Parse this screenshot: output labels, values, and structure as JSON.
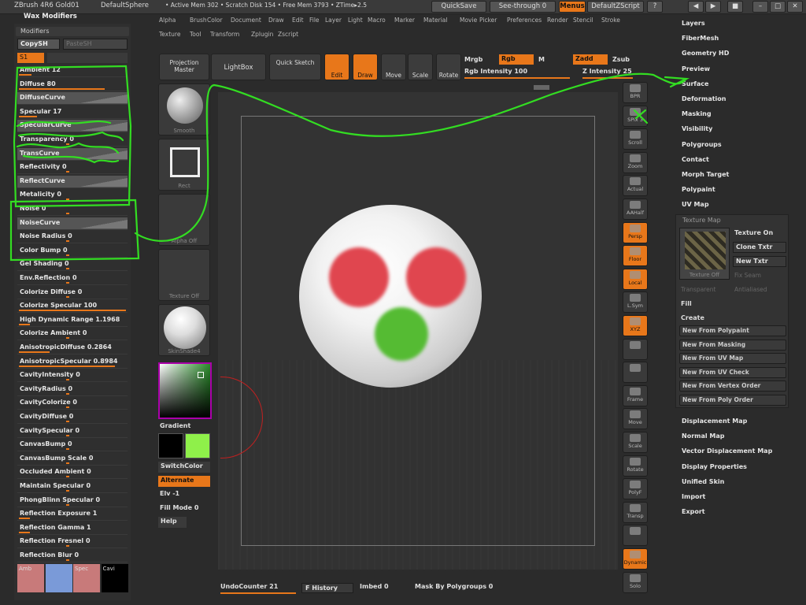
{
  "titlebar": {
    "app": "ZBrush 4R6 Gold01",
    "doc": "DefaultSphere",
    "mem": "• Active Mem 302  • Scratch Disk 154  • Free Mem 3793  • ZTime▸2.5",
    "quicksave": "QuickSave",
    "seethrough": "See-through  0",
    "menus": "Menus",
    "script": "DefaultZScript"
  },
  "menubar": {
    "row1": [
      "Alpha",
      "Brush",
      "Color",
      "Document",
      "Draw",
      "Edit",
      "File",
      "Layer",
      "Light",
      "Macro",
      "Marker",
      "Material",
      "Movie",
      "Picker",
      "Preferences",
      "Render",
      "Stencil",
      "Stroke"
    ],
    "row2": [
      "Texture",
      "Tool",
      "Transform",
      "Zplugin",
      "Zscript"
    ]
  },
  "leftpanel": {
    "title": "Wax Modifiers",
    "modifiers": "Modifiers",
    "copy": "CopySH",
    "paste": "PasteSH",
    "s1": "S1",
    "rows": [
      {
        "label": "Ambient 12",
        "fill": 0.12
      },
      {
        "label": "Diffuse 80",
        "fill": 0.8
      },
      {
        "label": "DiffuseCurve",
        "curve": true
      },
      {
        "label": "Specular 17",
        "fill": 0.17
      },
      {
        "label": "SpecularCurve",
        "curve": true
      },
      {
        "label": "Transparency 0",
        "fill": 0
      },
      {
        "label": "TransCurve",
        "curve": true
      },
      {
        "label": "Reflectivity 0",
        "fill": 0
      },
      {
        "label": "ReflectCurve",
        "curve": true
      },
      {
        "label": "Metalicity 0",
        "fill": 0
      },
      {
        "label": "Noise 0",
        "fill": 0
      },
      {
        "label": "NoiseCurve",
        "curve": true
      },
      {
        "label": "Noise Radius 0",
        "fill": 0
      },
      {
        "label": "Color Bump 0",
        "fill": 0
      },
      {
        "label": "Gel Shading 0",
        "fill": 0
      },
      {
        "label": "Env.Reflection 0",
        "fill": 0
      },
      {
        "label": "Colorize Diffuse 0",
        "fill": 0
      },
      {
        "label": "Colorize Specular 100",
        "fill": 1
      },
      {
        "label": "High Dynamic Range 1.1968",
        "fill": 0.1
      },
      {
        "label": "Colorize Ambient 0",
        "fill": 0
      },
      {
        "label": "AnisotropicDiffuse 0.2864",
        "fill": 0.29
      },
      {
        "label": "AnisotropicSpecular 0.8984",
        "fill": 0.9
      },
      {
        "label": "CavityIntensity 0",
        "fill": 0
      },
      {
        "label": "CavityRadius 0",
        "fill": 0
      },
      {
        "label": "CavityColorize 0",
        "fill": 0
      },
      {
        "label": "CavityDiffuse 0",
        "fill": 0
      },
      {
        "label": "CavitySpecular 0",
        "fill": 0
      },
      {
        "label": "CanvasBump 0",
        "fill": 0
      },
      {
        "label": "CanvasBump Scale 0",
        "fill": 0
      },
      {
        "label": "Occluded  Ambient 0",
        "fill": 0
      },
      {
        "label": "Maintain Specular 0",
        "fill": 0
      },
      {
        "label": "PhongBlinn Specular 0",
        "fill": 0
      },
      {
        "label": "Reflection Exposure 1",
        "fill": 0.1
      },
      {
        "label": "Reflection Gamma 1",
        "fill": 0.1
      },
      {
        "label": "Reflection Fresnel 0",
        "fill": 0
      },
      {
        "label": "Reflection Blur 0",
        "fill": 0
      }
    ],
    "swatches": [
      {
        "label": "Amb",
        "color": "#c87a7a"
      },
      {
        "label": "",
        "color": "#7a9ad8"
      },
      {
        "label": "Spec",
        "color": "#c87a7a"
      },
      {
        "label": "Cavi",
        "color": "#000000"
      }
    ]
  },
  "topbtns": {
    "projection": "Projection Master",
    "lightbox": "LightBox",
    "quicksketch": "Quick Sketch",
    "edit": "Edit",
    "draw": "Draw",
    "move": "Move",
    "scale": "Scale",
    "rotate": "Rotate",
    "mrgb": "Mrgb",
    "rgb": "Rgb",
    "m": "M",
    "zadd": "Zadd",
    "zsub": "Zsub",
    "rgbint": "Rgb Intensity 100",
    "zint": "Z Intensity 25"
  },
  "toolcol": {
    "smooth": "Smooth",
    "rect": "Rect",
    "alpha": "Alpha Off",
    "texture": "Texture Off",
    "matcap": "SkinShade4",
    "gradient": "Gradient",
    "switch": "SwitchColor",
    "alternate": "Alternate",
    "elv": "Elv -1",
    "fill": "Fill Mode 0",
    "help": "Help"
  },
  "shelf": [
    "BPR",
    "SPix 3",
    "Scroll",
    "Zoom",
    "Actual",
    "AAHalf",
    "Persp",
    "Floor",
    "Local",
    "L.Sym",
    "XYZ",
    "",
    "",
    "Frame",
    "Move",
    "Scale",
    "Rotate",
    "PolyF",
    "Transp",
    "",
    "Dynamic",
    "Solo"
  ],
  "rightmenu": {
    "items_top": [
      "Layers",
      "FiberMesh",
      "Geometry HD",
      "Preview",
      "Surface",
      "Deformation",
      "Masking",
      "Visibility",
      "Polygroups",
      "Contact",
      "Morph Target",
      "Polypaint",
      "UV Map"
    ],
    "items_bottom": [
      "Displacement Map",
      "Normal Map",
      "Vector Displacement Map",
      "Display Properties",
      "Unified Skin",
      "Import",
      "Export"
    ]
  },
  "texturemap": {
    "title": "Texture Map",
    "thumb": "Texture Off",
    "on": "Texture On",
    "clone": "Clone Txtr",
    "new": "New Txtr",
    "fix": "Fix Seam",
    "transparent": "Transparent",
    "antialiased": "Antialiased",
    "fill": "Fill",
    "create": "Create",
    "buttons": [
      "New From Polypaint",
      "New From Masking",
      "New From UV Map",
      "New From UV Check",
      "New From Vertex Order",
      "New From Poly Order"
    ]
  },
  "bottombar": {
    "undo": "UndoCounter 21",
    "history": "F History",
    "imbed": "Imbed 0",
    "mask": "Mask By Polygroups 0"
  },
  "colors": {
    "accent": "#e8771a",
    "annotation": "#33dd22",
    "sphere_red": "#e0464f",
    "sphere_green": "#55bb33"
  }
}
